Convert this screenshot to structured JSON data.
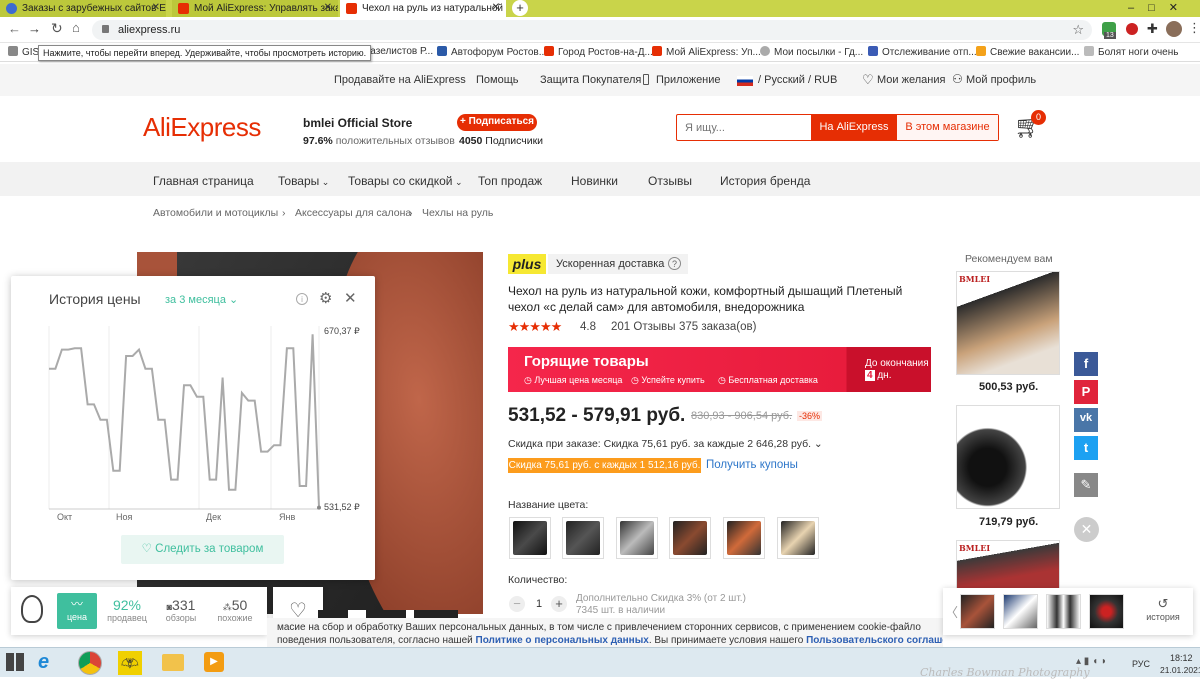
{
  "browser": {
    "tabs": [
      {
        "title": "Заказы с зарубежных сайтов Ei"
      },
      {
        "title": "Мой AliExpress: Управлять зака"
      },
      {
        "title": "Чехол на руль из натуральной"
      }
    ],
    "new_tab": "+",
    "url": "aliexpress.ru",
    "extension_badge": "13",
    "tooltip": "Нажмите, чтобы перейти вперед. Удерживайте, чтобы просмотреть историю.",
    "bookmarks": [
      "GIS",
      "луб Газелистов Р...",
      "Автофорум Ростов...",
      "Город Ростов-на-Д...",
      "Мой AliExpress: Уп...",
      "Мои посылки - Гд...",
      "Отслеживание отп...",
      "Свежие вакансии...",
      "Болят ноги очень"
    ]
  },
  "topnav": {
    "sell": "Продавайте на AliExpress",
    "help": "Помощь",
    "buyer_protection": "Защита Покупателя",
    "app": "Приложение",
    "lang": "/ Русский / RUB",
    "wishlist": "Мои желания",
    "profile": "Мой профиль"
  },
  "header": {
    "logo": "AliExpress",
    "store_name": "bmlei Official Store",
    "rating_pct": "97.6%",
    "rating_text": "положительных отзывов",
    "subscribe": "+ Подписаться",
    "subs_count": "4050",
    "subs_text": "Подписчики",
    "search_placeholder": "Я ищу...",
    "search_on_ali": "На AliExpress",
    "search_store": "В этом магазине",
    "cart_count": "0"
  },
  "catnav": [
    "Главная страница",
    "Товары",
    "Товары со скидкой",
    "Топ продаж",
    "Новинки",
    "Отзывы",
    "История бренда"
  ],
  "breadcrumb": [
    "Автомобили и мотоциклы",
    "Аксессуары для салона",
    "Чехлы на руль"
  ],
  "product": {
    "plus_badge": "plus",
    "fast_delivery": "Ускоренная доставка",
    "title": "Чехол на руль из натуральной кожи, комфортный дышащий Плетеный чехол «с делай сам» для автомобиля, внедорожника",
    "rating": "4.8",
    "reviews": "201 Отзывы",
    "orders": "375 заказа(ов)",
    "hot_title": "Горящие товары",
    "hot_features": [
      "Лучшая цена месяца",
      "Успейте купить",
      "Бесплатная доставка"
    ],
    "hot_until": "До окончания",
    "hot_days_num": "4",
    "hot_days": "дн.",
    "price": "531,52 - 579,91 руб.",
    "old_price": "830,93 - 906,54 руб.",
    "discount": "-36%",
    "order_discount": "Скидка при заказе: Скидка 75,61 руб. за каждые 2 646,28 руб.",
    "coupon": "Скидка 75,61 руб. с каждых 1 512,16 руб.",
    "get_coupons": "Получить купоны",
    "color_label": "Название цвета:",
    "qty_label": "Количество:",
    "qty": "1",
    "qty_discount": "Дополнительно Скидка 3% (от 2 шт.)",
    "stock": "7345 шт. в наличии"
  },
  "recommend": {
    "title": "Рекомендуем вам",
    "items": [
      {
        "brand": "BMLEI",
        "price": "500,53 руб."
      },
      {
        "price": "719,79 руб."
      },
      {
        "brand": "BMLEI"
      }
    ]
  },
  "price_history": {
    "title": "История цены",
    "period": "за 3 месяца",
    "y_max": "670,37 ₽",
    "y_min": "531,52 ₽",
    "x_labels": [
      "Окт",
      "Ноя",
      "Дек",
      "Янв"
    ],
    "follow": "Следить за товаром",
    "values": [
      640,
      640,
      655,
      655,
      656,
      656,
      612,
      612,
      600,
      600,
      560,
      560,
      650,
      650,
      655,
      640,
      640,
      600,
      600,
      553,
      553,
      627,
      627,
      618,
      618,
      553,
      553,
      633,
      545,
      545,
      621,
      615,
      615,
      575,
      575,
      580,
      580,
      656,
      656,
      548,
      548,
      667,
      531
    ]
  },
  "bottom_stats": {
    "price_label": "цена",
    "seller_pct": "92%",
    "seller_label": "продавец",
    "reviews_num": "331",
    "reviews_label": "обзоры",
    "similar_num": "50",
    "similar_label": "похожие"
  },
  "cookie": {
    "line1": "масие на сбор и обработку Ваших персональных данных, в том числе с привлечением сторонних сервисов, с применением cookie-файло",
    "line2a": "поведения пользователя, согласно нашей ",
    "privacy": "Политике о персональных данных",
    "line2b": ". Вы принимаете условия нашего ",
    "terms": "Пользовательского соглашения",
    "line2c": "."
  },
  "history_strip": {
    "label": "история"
  },
  "social": [
    "f",
    "P",
    "vk",
    "t",
    "✎"
  ],
  "taskbar": {
    "lang": "РУС",
    "time": "18:12",
    "date": "21.01.2021",
    "watermark": "Charles Bowman Photography"
  },
  "colors": {
    "accent": "#e62e04",
    "green": "#4caf50",
    "teal": "#3fbf9e"
  }
}
